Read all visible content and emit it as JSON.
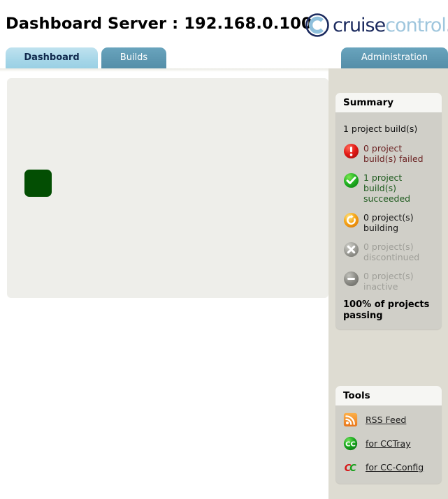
{
  "header": {
    "title": "Dashboard Server : 192.168.0.100",
    "logo": {
      "mark_icon": "circled-c-icon",
      "word_primary": "cruise",
      "word_secondary": "control",
      "dot": ".",
      "tm": "™",
      "color_primary": "#1b2a5e",
      "color_secondary": "#9fc6dd"
    }
  },
  "tabs": [
    {
      "id": "dashboard",
      "label": "Dashboard",
      "active": true
    },
    {
      "id": "builds",
      "label": "Builds",
      "active": false
    },
    {
      "id": "administration",
      "label": "Administration",
      "active": false
    }
  ],
  "main": {
    "build_tile": {
      "status": "succeeded",
      "color": "#034e03",
      "icon": "build-status-tile"
    }
  },
  "sidebar": {
    "summary": {
      "header": "Summary",
      "total_label": "1 project build(s)",
      "stats": [
        {
          "id": "failed",
          "icon": "error-circle-icon",
          "label": "0 project build(s) failed",
          "color": "#6b2323",
          "icon_color": "#e01b1b"
        },
        {
          "id": "succeeded",
          "icon": "check-circle-icon",
          "label": "1 project build(s) succeeded",
          "color": "#1d5a1d",
          "icon_color": "#2cb42c"
        },
        {
          "id": "building",
          "icon": "spinner-circle-icon",
          "label": "0 project(s) building",
          "color": "#141414",
          "icon_color": "#f3a81c"
        },
        {
          "id": "discontinued",
          "icon": "x-circle-icon",
          "label": "0 project(s) discontinued",
          "color": "#9e9e98",
          "icon_color": "#9a9a94"
        },
        {
          "id": "inactive",
          "icon": "minus-circle-icon",
          "label": "0 project(s) inactive",
          "color": "#9e9e98",
          "icon_color": "#8d8d87"
        }
      ],
      "passing_label": "100% of projects passing"
    },
    "tools": {
      "header": "Tools",
      "links": [
        {
          "id": "rss",
          "icon": "rss-feed-icon",
          "label": "RSS Feed"
        },
        {
          "id": "cctray",
          "icon": "cctray-icon",
          "label": "for CCTray"
        },
        {
          "id": "ccconfig",
          "icon": "cc-config-icon",
          "label": "for CC-Config"
        }
      ]
    }
  },
  "colors": {
    "page_bg": "#ffffff",
    "sidebar_bg": "#dedcd2",
    "panel_bg": "#d0cfc8",
    "panel_header_bg": "#f6f6f3",
    "main_panel_bg": "#eeeeea",
    "tab_active_bg": "#a6d6e8",
    "tab_inactive_bg": "#5c96b0"
  }
}
